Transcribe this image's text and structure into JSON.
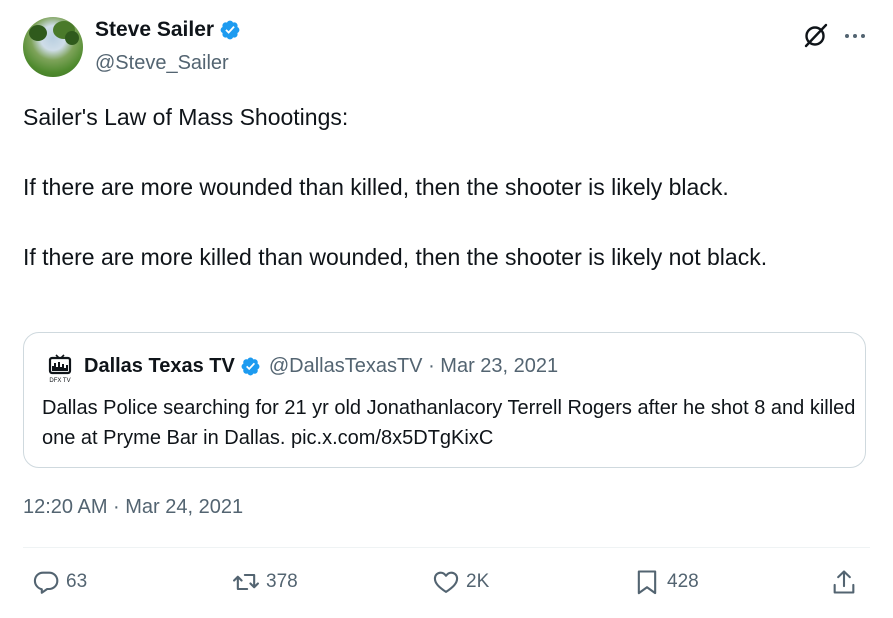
{
  "author": {
    "display_name": "Steve Sailer",
    "handle": "@Steve_Sailer",
    "verified": true
  },
  "tweet": {
    "text": "Sailer's Law of Mass Shootings:\n\nIf there are more wounded than killed, then the shooter is likely black.\n\nIf there are more killed than wounded, then the shooter is likely not black.",
    "timestamp": "12:20 AM · Mar 24, 2021"
  },
  "quoted_tweet": {
    "display_name": "Dallas Texas TV",
    "handle_date": "@DallasTexasTV · Mar 23, 2021",
    "verified": true,
    "text": "Dallas Police searching for 21 yr old Jonathanlacory Terrell Rogers after he shot 8 and killed one at Pryme Bar in Dallas. pic.x.com/8x5DTgKixC",
    "logo_text": "DFX TV"
  },
  "actions": {
    "replies": "63",
    "reposts": "378",
    "likes": "2K",
    "bookmarks": "428"
  },
  "colors": {
    "text": "#0f1419",
    "secondary": "#536471",
    "verified_blue": "#1d9bf0",
    "border": "#cfd9de"
  },
  "icons": [
    "verified-badge-icon",
    "grok-icon",
    "more-icon",
    "reply-icon",
    "repost-icon",
    "like-icon",
    "bookmark-icon",
    "share-icon"
  ]
}
